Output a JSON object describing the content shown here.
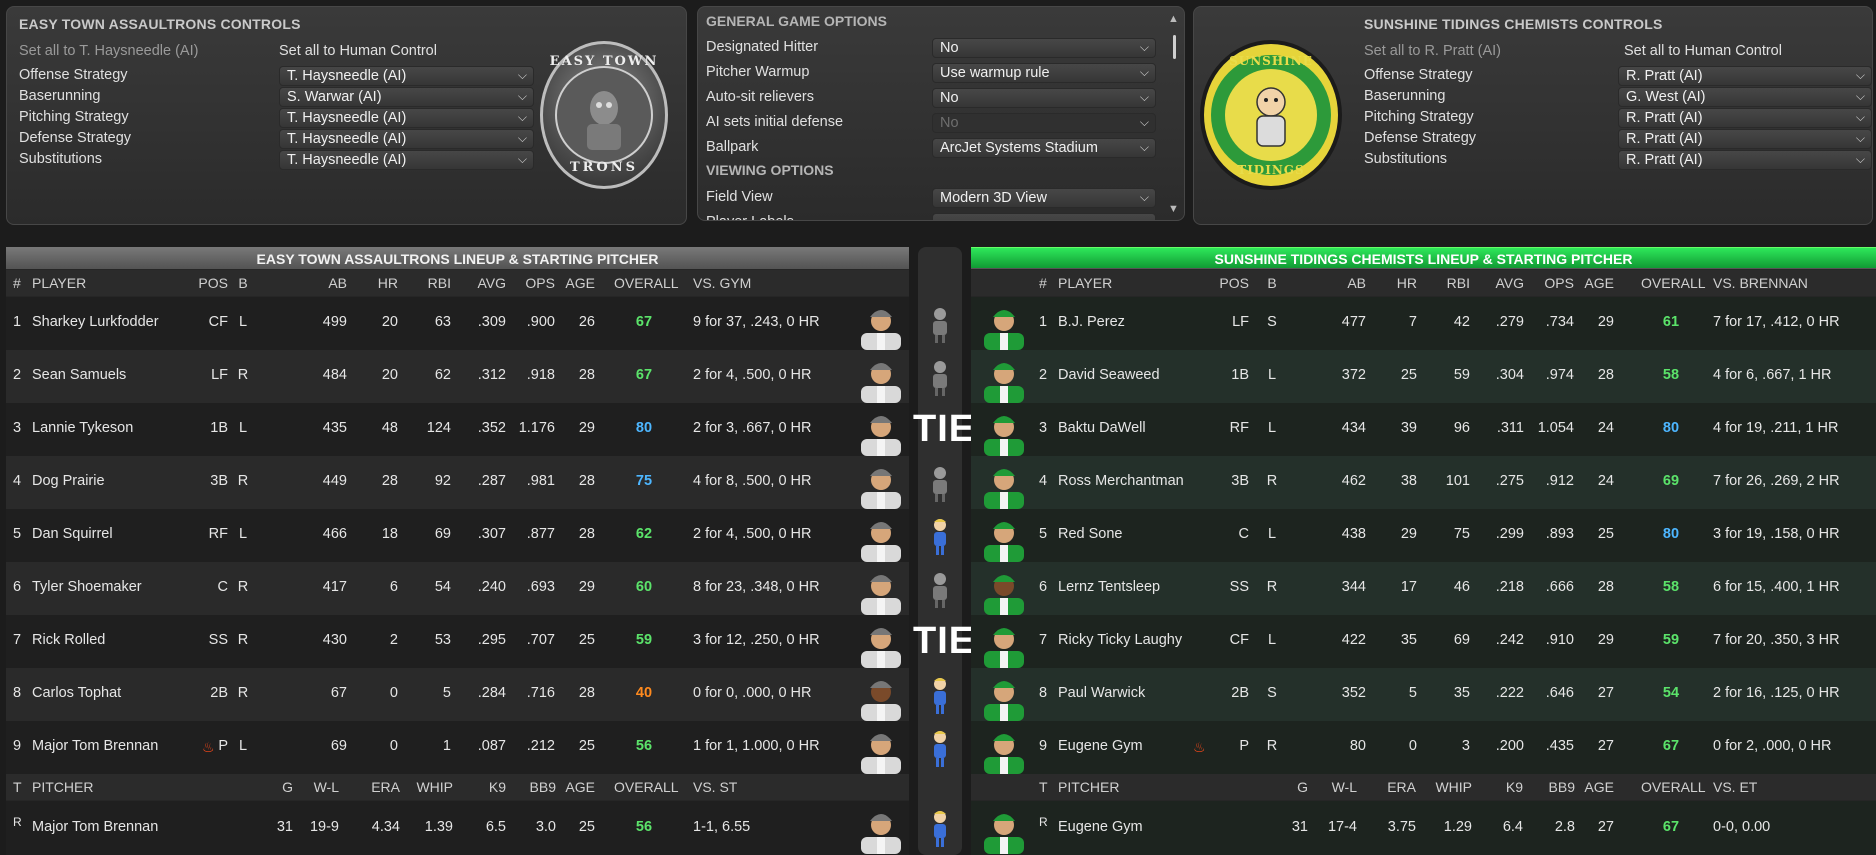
{
  "colors": {
    "green": "#5be36a",
    "blue": "#4db6ff",
    "orange": "#ff8a1e",
    "away_header": "#6a6a6a",
    "home_header": "#1fd34a"
  },
  "away_controls": {
    "title": "EASY TOWN ASSAULTRONS CONTROLS",
    "set_ai": "Set all to T. Haysneedle (AI)",
    "set_human": "Set all to Human Control",
    "rows": [
      {
        "label": "Offense Strategy",
        "value": "T. Haysneedle (AI)"
      },
      {
        "label": "Baserunning",
        "value": "S. Warwar (AI)"
      },
      {
        "label": "Pitching Strategy",
        "value": "T. Haysneedle (AI)"
      },
      {
        "label": "Defense Strategy",
        "value": "T. Haysneedle (AI)"
      },
      {
        "label": "Substitutions",
        "value": "T. Haysneedle (AI)"
      }
    ],
    "logo_top": "EASY TOWN",
    "logo_bottom": "TRONS"
  },
  "home_controls": {
    "title": "SUNSHINE TIDINGS CHEMISTS CONTROLS",
    "set_ai": "Set all to R. Pratt (AI)",
    "set_human": "Set all to Human Control",
    "rows": [
      {
        "label": "Offense Strategy",
        "value": "R. Pratt (AI)"
      },
      {
        "label": "Baserunning",
        "value": "G. West (AI)"
      },
      {
        "label": "Pitching Strategy",
        "value": "R. Pratt (AI)"
      },
      {
        "label": "Defense Strategy",
        "value": "R. Pratt (AI)"
      },
      {
        "label": "Substitutions",
        "value": "R. Pratt (AI)"
      }
    ],
    "logo_top": "SUNSHINE",
    "logo_bottom": "TIDINGS"
  },
  "game_options": {
    "title": "GENERAL GAME OPTIONS",
    "rows": [
      {
        "label": "Designated Hitter",
        "value": "No"
      },
      {
        "label": "Pitcher Warmup",
        "value": "Use warmup rule"
      },
      {
        "label": "Auto-sit relievers",
        "value": "No"
      },
      {
        "label": "AI sets initial defense",
        "value": "No"
      },
      {
        "label": "Ballpark",
        "value": "ArcJet Systems Stadium"
      }
    ],
    "viewing_title": "VIEWING OPTIONS",
    "viewing_rows": [
      {
        "label": "Field View",
        "value": "Modern 3D View"
      },
      {
        "label": "Player Labels",
        "value": ""
      }
    ]
  },
  "away_lineup": {
    "title": "EASY TOWN ASSAULTRONS LINEUP & STARTING PITCHER",
    "cols": {
      "num": "#",
      "player": "PLAYER",
      "pos": "POS",
      "b": "B",
      "ab": "AB",
      "hr": "HR",
      "rbi": "RBI",
      "avg": "AVG",
      "ops": "OPS",
      "age": "AGE",
      "overall": "OVERALL",
      "vs": "VS. GYM"
    },
    "players": [
      {
        "n": "1",
        "name": "Sharkey Lurkfodder",
        "pos": "CF",
        "b": "L",
        "ab": "499",
        "hr": "20",
        "rbi": "63",
        "avg": ".309",
        "ops": ".900",
        "age": "26",
        "ovr": "67",
        "vs": "9 for 37, .243, 0 HR"
      },
      {
        "n": "2",
        "name": "Sean Samuels",
        "pos": "LF",
        "b": "R",
        "ab": "484",
        "hr": "20",
        "rbi": "62",
        "avg": ".312",
        "ops": ".918",
        "age": "28",
        "ovr": "67",
        "vs": "2 for 4, .500, 0 HR"
      },
      {
        "n": "3",
        "name": "Lannie Tykeson",
        "pos": "1B",
        "b": "L",
        "ab": "435",
        "hr": "48",
        "rbi": "124",
        "avg": ".352",
        "ops": "1.176",
        "age": "29",
        "ovr": "80",
        "vs": "2 for 3, .667, 0 HR"
      },
      {
        "n": "4",
        "name": "Dog Prairie",
        "pos": "3B",
        "b": "R",
        "ab": "449",
        "hr": "28",
        "rbi": "92",
        "avg": ".287",
        "ops": ".981",
        "age": "28",
        "ovr": "75",
        "vs": "4 for 8, .500, 0 HR"
      },
      {
        "n": "5",
        "name": "Dan Squirrel",
        "pos": "RF",
        "b": "L",
        "ab": "466",
        "hr": "18",
        "rbi": "69",
        "avg": ".307",
        "ops": ".877",
        "age": "28",
        "ovr": "62",
        "vs": "2 for 4, .500, 0 HR"
      },
      {
        "n": "6",
        "name": "Tyler Shoemaker",
        "pos": "C",
        "b": "R",
        "ab": "417",
        "hr": "6",
        "rbi": "54",
        "avg": ".240",
        "ops": ".693",
        "age": "29",
        "ovr": "60",
        "vs": "8 for 23, .348, 0 HR"
      },
      {
        "n": "7",
        "name": "Rick Rolled",
        "pos": "SS",
        "b": "R",
        "ab": "430",
        "hr": "2",
        "rbi": "53",
        "avg": ".295",
        "ops": ".707",
        "age": "25",
        "ovr": "59",
        "vs": "3 for 12, .250, 0 HR"
      },
      {
        "n": "8",
        "name": "Carlos Tophat",
        "pos": "2B",
        "b": "R",
        "ab": "67",
        "hr": "0",
        "rbi": "5",
        "avg": ".284",
        "ops": ".716",
        "age": "28",
        "ovr": "40",
        "vs": "0 for 0, .000, 0 HR"
      },
      {
        "n": "9",
        "name": "Major Tom Brennan",
        "pos": "P",
        "b": "L",
        "ab": "69",
        "hr": "0",
        "rbi": "1",
        "avg": ".087",
        "ops": ".212",
        "age": "25",
        "ovr": "56",
        "vs": "1 for 1, 1.000, 0 HR"
      }
    ],
    "pcols": {
      "t": "T",
      "pitcher": "PITCHER",
      "g": "G",
      "wl": "W-L",
      "era": "ERA",
      "whip": "WHIP",
      "k9": "K9",
      "bb9": "BB9",
      "age": "AGE",
      "overall": "OVERALL",
      "vs": "VS. ST"
    },
    "pitcher": {
      "t": "R",
      "name": "Major Tom Brennan",
      "g": "31",
      "wl": "19-9",
      "era": "4.34",
      "whip": "1.39",
      "k9": "6.5",
      "bb9": "3.0",
      "age": "25",
      "ovr": "56",
      "vs": "1-1, 6.55"
    }
  },
  "home_lineup": {
    "title": "SUNSHINE TIDINGS CHEMISTS LINEUP & STARTING PITCHER",
    "cols": {
      "num": "#",
      "player": "PLAYER",
      "pos": "POS",
      "b": "B",
      "ab": "AB",
      "hr": "HR",
      "rbi": "RBI",
      "avg": "AVG",
      "ops": "OPS",
      "age": "AGE",
      "overall": "OVERALL",
      "vs": "VS. BRENNAN"
    },
    "players": [
      {
        "n": "1",
        "name": "B.J. Perez",
        "pos": "LF",
        "b": "S",
        "ab": "477",
        "hr": "7",
        "rbi": "42",
        "avg": ".279",
        "ops": ".734",
        "age": "29",
        "ovr": "61",
        "vs": "7 for 17, .412, 0 HR"
      },
      {
        "n": "2",
        "name": "David Seaweed",
        "pos": "1B",
        "b": "L",
        "ab": "372",
        "hr": "25",
        "rbi": "59",
        "avg": ".304",
        "ops": ".974",
        "age": "28",
        "ovr": "58",
        "vs": "4 for 6, .667, 1 HR"
      },
      {
        "n": "3",
        "name": "Baktu DaWell",
        "pos": "RF",
        "b": "L",
        "ab": "434",
        "hr": "39",
        "rbi": "96",
        "avg": ".311",
        "ops": "1.054",
        "age": "24",
        "ovr": "80",
        "vs": "4 for 19, .211, 1 HR"
      },
      {
        "n": "4",
        "name": "Ross Merchantman",
        "pos": "3B",
        "b": "R",
        "ab": "462",
        "hr": "38",
        "rbi": "101",
        "avg": ".275",
        "ops": ".912",
        "age": "24",
        "ovr": "69",
        "vs": "7 for 26, .269, 2 HR"
      },
      {
        "n": "5",
        "name": "Red Sone",
        "pos": "C",
        "b": "L",
        "ab": "438",
        "hr": "29",
        "rbi": "75",
        "avg": ".299",
        "ops": ".893",
        "age": "25",
        "ovr": "80",
        "vs": "3 for 19, .158, 0 HR"
      },
      {
        "n": "6",
        "name": "Lernz Tentsleep",
        "pos": "SS",
        "b": "R",
        "ab": "344",
        "hr": "17",
        "rbi": "46",
        "avg": ".218",
        "ops": ".666",
        "age": "28",
        "ovr": "58",
        "vs": "6 for 15, .400, 1 HR"
      },
      {
        "n": "7",
        "name": "Ricky Ticky Laughy",
        "pos": "CF",
        "b": "L",
        "ab": "422",
        "hr": "35",
        "rbi": "69",
        "avg": ".242",
        "ops": ".910",
        "age": "29",
        "ovr": "59",
        "vs": "7 for 20, .350, 3 HR"
      },
      {
        "n": "8",
        "name": "Paul Warwick",
        "pos": "2B",
        "b": "S",
        "ab": "352",
        "hr": "5",
        "rbi": "35",
        "avg": ".222",
        "ops": ".646",
        "age": "27",
        "ovr": "54",
        "vs": "2 for 16, .125, 0 HR"
      },
      {
        "n": "9",
        "name": "Eugene Gym",
        "pos": "P",
        "b": "R",
        "ab": "80",
        "hr": "0",
        "rbi": "3",
        "avg": ".200",
        "ops": ".435",
        "age": "27",
        "ovr": "67",
        "vs": "0 for 2, .000, 0 HR"
      }
    ],
    "pcols": {
      "t": "T",
      "pitcher": "PITCHER",
      "g": "G",
      "wl": "W-L",
      "era": "ERA",
      "whip": "WHIP",
      "k9": "K9",
      "bb9": "BB9",
      "age": "AGE",
      "overall": "OVERALL",
      "vs": "VS. ET"
    },
    "pitcher": {
      "t": "R",
      "name": "Eugene Gym",
      "g": "31",
      "wl": "17-4",
      "era": "3.75",
      "whip": "1.29",
      "k9": "6.4",
      "bb9": "2.8",
      "age": "27",
      "ovr": "67",
      "vs": "0-0, 0.00"
    }
  },
  "matchups": {
    "tie_label": "TIE",
    "rows": [
      "robot",
      "robot",
      "tie",
      "robot",
      "vaultboy",
      "robot",
      "tie",
      "vaultboy",
      "vaultboy"
    ],
    "pitcher": "vaultboy"
  }
}
